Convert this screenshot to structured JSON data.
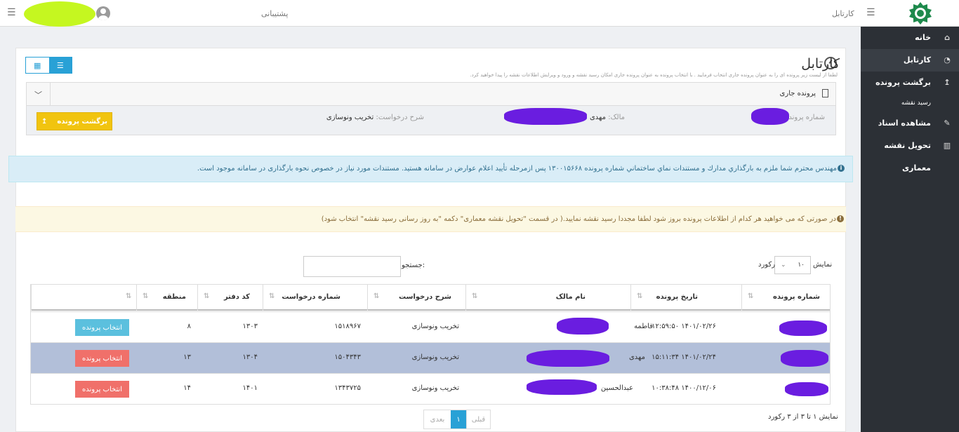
{
  "topbar": {
    "support": "پشتیبانی",
    "kartabl": "کارتابل"
  },
  "sidebar": {
    "items": [
      {
        "label": "خانه",
        "icon": "home-icon"
      },
      {
        "label": "کارتابل",
        "icon": "dashboard-icon"
      },
      {
        "label": "برگشت پرونده",
        "icon": "upload-icon"
      },
      {
        "label": "رسید نقشه",
        "icon": ""
      },
      {
        "label": "مشاهده اسناد",
        "icon": "paperclip-icon"
      },
      {
        "label": "تحویل نقشه معماری",
        "icon": "map-icon"
      }
    ]
  },
  "page": {
    "title": "کارتابل",
    "description": "لطفا از لیست زیر پرونده ای را به عنوان پرونده جاری انتخاب فرمایید . با انتخاب پرونده به عنوان پرونده جاری امکان رسید نقشه و ورود و ویرایش اطلاعات نقشه را پیدا خواهید کرد."
  },
  "current_file": {
    "title": "پرونده جاری",
    "file_no_label": "شماره پرونده:",
    "owner_label": "مالک:",
    "owner_value": "مهدی",
    "request_label": "شرح درخواست:",
    "request_value": "تخریب ونوسازی",
    "return_button": "برگشت پرونده"
  },
  "alerts": {
    "info": "مهندس محترم شما ملزم به بارگذاري مدارك و مستندات نماي ساختماني شماره پرونده ۱۳۰۰۱۵۶۶۸ پس ازمرحله تأييد اعلام عوارض در سامانه هستید. مستندات مورد نیاز در خصوص نحوه بارگذاری در سامانه موجود است.",
    "warning": "در صورتی که می خواهید هر کدام از اطلاعات پرونده بروز شود لطفا مجددا رسید نقشه نمایید.( در قسمت \"تحویل نقشه معماری\" دکمه \"به روز رسانی رسید نقشه\" انتخاب شود)"
  },
  "table_controls": {
    "show_label": "نمایش",
    "length_value": "۱۰",
    "records_label": "رکورد",
    "search_label": "جستجو:"
  },
  "table": {
    "headers": [
      "شماره پرونده",
      "تاریخ پرونده",
      "نام مالک",
      "شرح درخواست",
      "شماره درخواست",
      "کد دفتر",
      "منطقه",
      ""
    ],
    "rows": [
      {
        "date": "۱۴۰۱/۰۲/۲۶ ۱۲:۵۹:۵۰",
        "owner": "فاطمه",
        "desc": "تخریب ونوسازی",
        "req_no": "۱۵۱۸۹۶۷",
        "office": "۱۳۰۳",
        "region": "۸",
        "button": "انتخاب پرونده",
        "selected": false
      },
      {
        "date": "۱۴۰۱/۰۲/۲۴ ۱۵:۱۱:۳۴",
        "owner": "مهدی",
        "desc": "تخریب ونوسازی",
        "req_no": "۱۵۰۴۳۴۳",
        "office": "۱۳۰۴",
        "region": "۱۳",
        "button": "انتخاب پرونده",
        "selected": true
      },
      {
        "date": "۱۴۰۰/۱۲/۰۶ ۱۰:۳۸:۴۸",
        "owner": "عبدالحسین",
        "desc": "تخریب ونوسازی",
        "req_no": "۱۳۴۳۷۲۵",
        "office": "۱۴۰۱",
        "region": "۱۴",
        "button": "انتخاب پرونده",
        "selected": false
      }
    ]
  },
  "pagination": {
    "info": "نمایش ۱ تا ۳ از ۳ رکورد",
    "prev": "قبلی",
    "current": "۱",
    "next": "بعدی"
  },
  "colors": {
    "sidebar_bg": "#2c3036",
    "primary": "#29a1d6",
    "warning_button": "#f1c40f",
    "danger_button": "#f0706a",
    "info_button": "#5bc0de",
    "selected_row": "#b2bfd9",
    "redaction_yellow": "#c5f720",
    "redaction_purple": "#6a1de0"
  }
}
